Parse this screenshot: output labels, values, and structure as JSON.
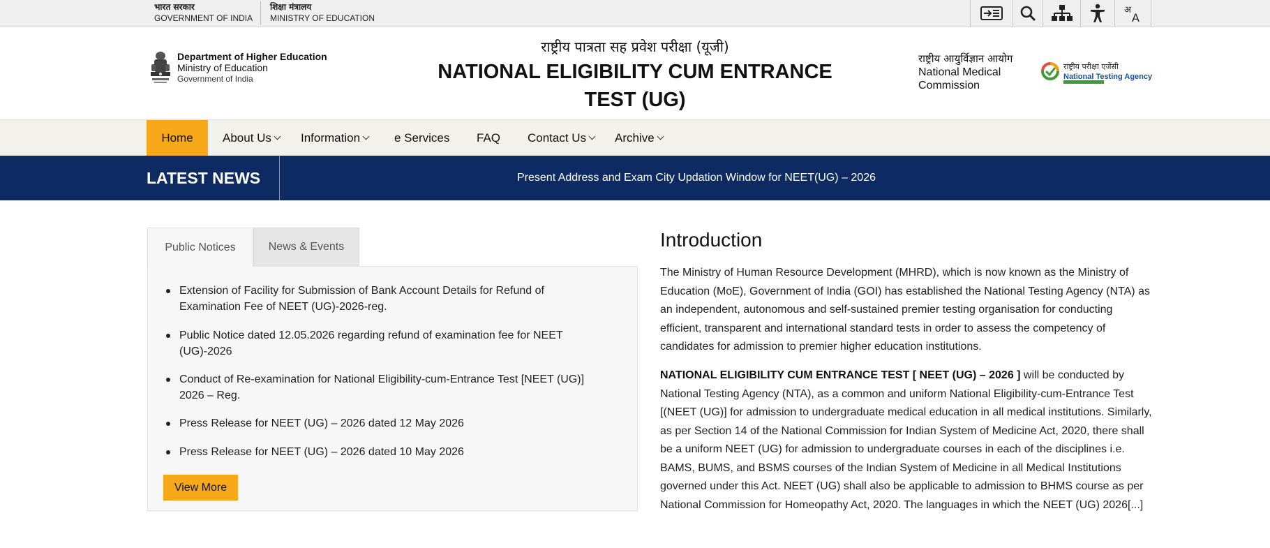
{
  "gov_strip": {
    "govt_hi": "भारत सरकार",
    "govt_en": "GOVERNMENT OF INDIA",
    "ministry_hi": "शिक्षा मंत्रालय",
    "ministry_en": "MINISTRY OF EDUCATION",
    "tools": [
      "skip-to-content-icon",
      "search-icon",
      "sitemap-icon",
      "accessibility-icon",
      "language-icon"
    ]
  },
  "header": {
    "dept_line1": "Department of Higher Education",
    "dept_line2": "Ministry of Education",
    "dept_line3": "Government of India",
    "title_hi": "राष्ट्रीय पात्रता सह प्रवेश परीक्षा (यूजी)",
    "title_en": "NATIONAL ELIGIBILITY CUM ENTRANCE TEST (UG)",
    "nmc_hi": "राष्ट्रीय आयुर्विज्ञान आयोग",
    "nmc_en_line1": "National Medical",
    "nmc_en_line2": "Commission",
    "nta_hi": "राष्ट्रीय परीक्षा एजेंसी",
    "nta_en": "National Testing Agency"
  },
  "nav": {
    "items": [
      {
        "label": "Home",
        "active": true,
        "dropdown": false
      },
      {
        "label": "About Us",
        "active": false,
        "dropdown": true
      },
      {
        "label": "Information",
        "active": false,
        "dropdown": true
      },
      {
        "label": "e Services",
        "active": false,
        "dropdown": false
      },
      {
        "label": "FAQ",
        "active": false,
        "dropdown": false
      },
      {
        "label": "Contact Us",
        "active": false,
        "dropdown": true
      },
      {
        "label": "Archive",
        "active": false,
        "dropdown": true
      }
    ]
  },
  "news": {
    "label": "LATEST NEWS",
    "headline": "Present Address and Exam City Updation Window for NEET(UG) – 2026"
  },
  "tabs": {
    "public_notices": "Public Notices",
    "news_events": "News & Events",
    "active": "Public Notices"
  },
  "notices": [
    "Extension of Facility for Submission of Bank Account Details for Refund of Examination Fee of NEET (UG)-2026-reg.",
    "Public Notice dated 12.05.2026 regarding refund of examination fee for NEET (UG)-2026",
    "Conduct of Re-examination for National Eligibility-cum-Entrance Test [NEET (UG)] 2026 – Reg.",
    "Press Release for NEET (UG) – 2026 dated 12 May 2026",
    "Press Release for NEET (UG) – 2026 dated 10 May 2026"
  ],
  "view_more": "View More",
  "intro": {
    "title": "Introduction",
    "para1": "The Ministry of Human Resource Development (MHRD), which is now known as the Ministry of Education (MoE), Government of India (GOI) has established the National Testing Agency (NTA) as an independent, autonomous and self-sustained premier testing organisation for conducting efficient, transparent and international standard tests in order to assess the competency of candidates for admission to premier higher education institutions.",
    "para2_bold": "NATIONAL ELIGIBILITY CUM ENTRANCE TEST [ NEET (UG) – 2026 ]",
    "para2_rest": " will be conducted by National Testing Agency (NTA), as a common and uniform National Eligibility-cum-Entrance Test [(NEET (UG)] for admission to undergraduate medical education in all medical institutions. Similarly, as per Section 14 of the National Commission for Indian System of Medicine Act, 2020, there shall be a uniform NEET (UG) for admission to undergraduate courses in each of the disciplines i.e. BAMS, BUMS, and BSMS courses of the Indian System of Medicine in all Medical Institutions governed under this Act. NEET (UG) shall also be applicable to admission to BHMS course as per National Commission for Homeopathy Act, 2020. The languages in which the NEET (UG) 2026",
    "read_more": "[...]"
  },
  "colors": {
    "accent_orange": "#f8a91a",
    "news_navy": "#0d2b62",
    "nav_bg": "#f2f1eb",
    "nta_green": "#3f9b35",
    "nta_blue": "#1d4f9c"
  }
}
